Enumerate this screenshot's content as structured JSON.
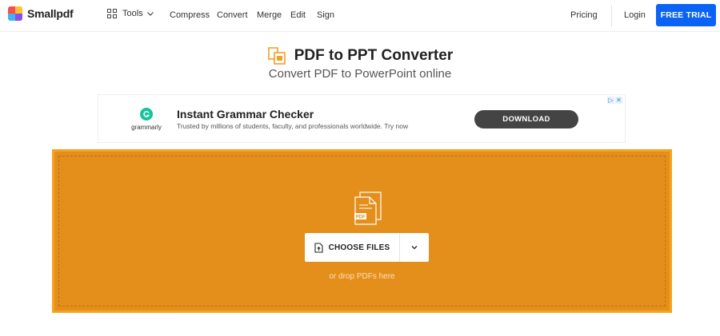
{
  "nav": {
    "logo_text": "Smallpdf",
    "tools_label": "Tools",
    "links": [
      "Compress",
      "Convert",
      "Merge",
      "Edit",
      "Sign"
    ],
    "pricing": "Pricing",
    "login": "Login",
    "free_trial": "FREE TRIAL"
  },
  "header": {
    "title": "PDF to PPT Converter",
    "subtitle": "Convert PDF to PowerPoint online",
    "accent_color": "#f0a024"
  },
  "ad": {
    "brand": "grammarly",
    "headline": "Instant Grammar Checker",
    "description": "Trusted by millions of students, faculty, and professionals worldwide. Try now",
    "cta": "DOWNLOAD",
    "choices_icons": [
      "adchoices-icon",
      "close-icon"
    ]
  },
  "dropzone": {
    "choose_label": "CHOOSE FILES",
    "hint": "or drop PDFs here",
    "bg_color": "#e48f1c",
    "file_badge": "PDF"
  },
  "colors": {
    "primary": "#0b63f6",
    "logo": [
      "#f54f4f",
      "#ffc22c",
      "#43b3f0",
      "#8a4fe8"
    ]
  }
}
